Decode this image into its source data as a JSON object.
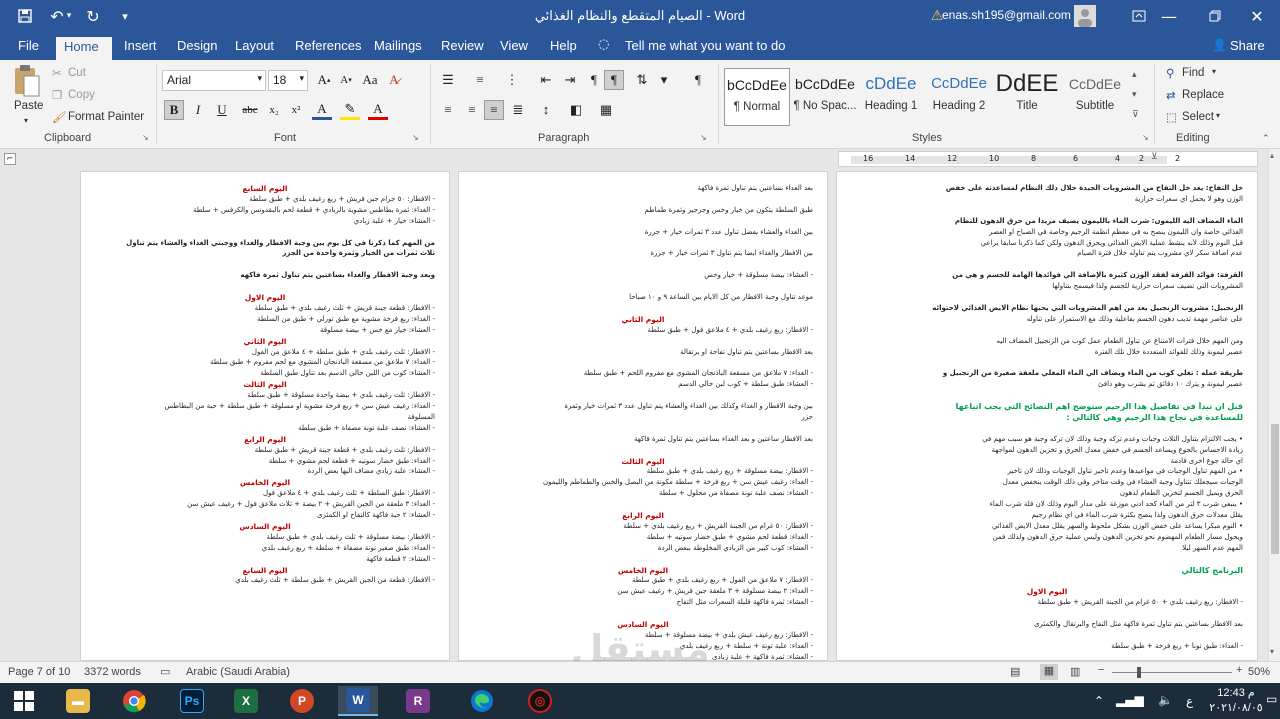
{
  "title_bar": {
    "document_title": "الصيام المتقطع والنظام الغذائي - Word",
    "account": "enas.sh195@gmail.com"
  },
  "tabs": [
    "File",
    "Home",
    "Insert",
    "Design",
    "Layout",
    "References",
    "Mailings",
    "Review",
    "View",
    "Help"
  ],
  "tell_me": "Tell me what you want to do",
  "share": "Share",
  "clipboard": {
    "paste": "Paste",
    "cut": "Cut",
    "copy": "Copy",
    "format_painter": "Format Painter",
    "group": "Clipboard"
  },
  "font": {
    "name": "Arial",
    "size": "18",
    "group": "Font"
  },
  "paragraph": {
    "group": "Paragraph"
  },
  "styles": {
    "group": "Styles",
    "items": [
      {
        "preview": "bCcDdEe",
        "name": "¶ Normal"
      },
      {
        "preview": "bCcDdEe",
        "name": "¶ No Spac..."
      },
      {
        "preview": "cDdEe",
        "name": "Heading 1"
      },
      {
        "preview": "CcDdEe",
        "name": "Heading 2"
      },
      {
        "preview": "DdEE",
        "name": "Title"
      },
      {
        "preview": "CcDdEe",
        "name": "Subtitle"
      }
    ]
  },
  "editing": {
    "find": "Find",
    "replace": "Replace",
    "select": "Select",
    "group": "Editing"
  },
  "ruler_marks": [
    "16",
    "14",
    "12",
    "10",
    "8",
    "6",
    "4",
    "2",
    "2"
  ],
  "pages": {
    "right": [
      {
        "t": "خل التفاح: يعد خل التفاح من المشروبات الجيدة خلال ذلك النظام لمساعدته على خفض",
        "c": "b"
      },
      {
        "t": "الوزن وهو لا يحمل اي سعرات حرارية",
        "c": ""
      },
      {
        "t": "",
        "c": ""
      },
      {
        "t": "الماء المضاف اليه الليمون: شرب الماء بالليمون يضيف مزيدا من حرق الدهون للنظام",
        "c": "b"
      },
      {
        "t": "الغذائي خاصة وان الليمون ينصح به في معظم انظمة الرجيم وخاصة في الصباح او العصر",
        "c": ""
      },
      {
        "t": "قبل النوم وذلك لأنه ينشط عملية الايض الغذائي ويحرق الدهون ولكن كما ذكرنا سابقا يراعي",
        "c": ""
      },
      {
        "t": "عدم اضافة سكر لاي مشروب يتم تناوله خلال فترة الصيام",
        "c": ""
      },
      {
        "t": "",
        "c": ""
      },
      {
        "t": "القرفة: فوائد القرفة لفقد الوزن كثيرة بالإضافة الي فوائدها الهامة للجسم و هي من",
        "c": "b"
      },
      {
        "t": "المشروبات التي تضيف سعرات حرارية للجسم ولذا فيسمح بتناولها",
        "c": ""
      },
      {
        "t": "",
        "c": ""
      },
      {
        "t": "الزنجبيل: مشروب الزنجبيل يعد من اهم المشروبات التي يحبها نظام الايض الغذائي لاحتوائه",
        "c": "b"
      },
      {
        "t": "على عناصر مهمة تذيب دهون الجسم بفاعلية وذلك مع الاستمرار على تناوله",
        "c": ""
      },
      {
        "t": "",
        "c": ""
      },
      {
        "t": "ومن المهم خلال فترات الامتناع عن تناول الطعام عمل كوب من الزنجبيل المضاف اليه",
        "c": ""
      },
      {
        "t": "عصير ليمونة وذلك للفوائد المتعددة خلال تلك الفترة",
        "c": ""
      },
      {
        "t": "",
        "c": ""
      },
      {
        "t": "طريقة عمله : تغلي كوب من الماء ويضاف الي الماء المغلي ملعقة صغيرة من الزنجبيل و",
        "c": "b"
      },
      {
        "t": "عصير ليمونة و يترك ١٠ دقائق ثم يشرب وهو دافئ",
        "c": ""
      },
      {
        "t": "",
        "c": ""
      },
      {
        "t": "قبل ان نبدأ في تفاصيل هذا الرجيم سنوضح اهم النصائح التي يجب اتباعها",
        "c": "g"
      },
      {
        "t": "للمساعدة في نجاح هذا الرجيم وهي كالتالي :",
        "c": "g"
      },
      {
        "t": "",
        "c": ""
      },
      {
        "t": "•  يجب الالتزام بتناول الثلاث وجبات وعدم تركه وجبة وذلك لان تركه وجبة هو سبب مهم في",
        "c": ""
      },
      {
        "t": "زيادة الاحساس بالجوع ويساعد الجسم في خفض معدل الحرق و تخزين الدهون لمواجهة",
        "c": ""
      },
      {
        "t": "اي حالة جوع اخرى قادمة",
        "c": ""
      },
      {
        "t": "•  من المهم تناول الوجبات في مواعيدها وعدم تأخير تناول الوجبات وذلك لان تأخير",
        "c": ""
      },
      {
        "t": "الوجبات سيجعلك تتناول وجبة العشاء في وقت متأخر وفي ذلك الوقت ينخفض معدل",
        "c": ""
      },
      {
        "t": "الحرق ويميل الجسم لتخزين الطعام لدهون",
        "c": ""
      },
      {
        "t": "•  ينبغي شرب ٣ لتر من الماء كحد ادني موزعة على مدار اليوم وذلك لان قلة شرب الماء",
        "c": ""
      },
      {
        "t": "يقلل معدلات حرق الدهون ولذا ينصح بكثرة شرب الماء في اي نظام رجيم",
        "c": ""
      },
      {
        "t": "•  النوم مبكرا يساعد على خفض الوزن بشكل ملحوظ والسهر يقلل معدل الايض الغذائي",
        "c": ""
      },
      {
        "t": "ويحول مسار الطعام المهضوم نحو تخزين الدهون وليس عملية حرق الدهون ولذلك فمن",
        "c": ""
      },
      {
        "t": "المهم عدم السهر ليلا",
        "c": ""
      },
      {
        "t": "",
        "c": ""
      },
      {
        "t": "البرنامج كالتالي",
        "c": "g"
      },
      {
        "t": "",
        "c": ""
      },
      {
        "t": "اليوم الاول",
        "c": "h"
      },
      {
        "t": "-  الافطار: ربع رغيف بلدي + ٥٠ غرام من الجبنة القريش + طبق سلطة",
        "c": ""
      },
      {
        "t": "",
        "c": ""
      },
      {
        "t": "بعد الافطار بساعتين يتم تناول ثمرة فاكهة مثل التفاح والبرتقال والكمثرى",
        "c": ""
      },
      {
        "t": "",
        "c": ""
      },
      {
        "t": "-  الغداء: طبق تونا + ربع فرخة + طبق سلطة",
        "c": ""
      }
    ],
    "middle": [
      {
        "t": "بعد الغداء بساعتين يتم تناول ثمرة فاكهة",
        "c": ""
      },
      {
        "t": "",
        "c": ""
      },
      {
        "t": "طبق السلطة يتكون من خيار وخس وجرجير وثمرة طماطم",
        "c": ""
      },
      {
        "t": "",
        "c": ""
      },
      {
        "t": "بين الغداء والعشاء يفضل تناول عدد ٣ ثمرات خيار + جزرة",
        "c": ""
      },
      {
        "t": "",
        "c": ""
      },
      {
        "t": "بين الافطار والغداء ايضا يتم تناول ٣ ثمرات خيار + جزرة",
        "c": ""
      },
      {
        "t": "",
        "c": ""
      },
      {
        "t": "-  العشاء: بيضة مسلوقة + خيار وخس",
        "c": ""
      },
      {
        "t": "",
        "c": ""
      },
      {
        "t": "موعد تناول وجبة الافطار من كل الايام بين الساعة ٩ و ١٠ صباحا",
        "c": ""
      },
      {
        "t": "",
        "c": ""
      },
      {
        "t": "اليوم الثاني",
        "c": "h"
      },
      {
        "t": "-  الافطار: ربع رغيف بلدي + ٤ ملاعق فول + طبق سلطة",
        "c": ""
      },
      {
        "t": "",
        "c": ""
      },
      {
        "t": "بعد الافطار بساعتين يتم تناول تفاحة او برتقالة",
        "c": ""
      },
      {
        "t": "",
        "c": ""
      },
      {
        "t": "-  الغداء: ٧ ملاعق من مسقعة الباذنجان المشوي مع مفروم اللحم + طبق سلطة",
        "c": ""
      },
      {
        "t": "-  العشاء: طبق سلطة + كوب لبن خالي الدسم",
        "c": ""
      },
      {
        "t": "",
        "c": ""
      },
      {
        "t": "بين وجبة الافطار و الغداء وكذلك بين الغداء والعشاء يتم تناول عدد ٣ ثمرات خيار وثمرة",
        "c": ""
      },
      {
        "t": "جزر",
        "c": ""
      },
      {
        "t": "",
        "c": ""
      },
      {
        "t": "بعد الافطار ساعتين و بعد الغداء بساعتين يتم تناول ثمرة فاكهة",
        "c": ""
      },
      {
        "t": "",
        "c": ""
      },
      {
        "t": "اليوم الثالث",
        "c": "h"
      },
      {
        "t": "-  الافطار: بيضة مسلوقة + ربع رغيف بلدي + طبق سلطة",
        "c": ""
      },
      {
        "t": "-  الغداء: رغيف عيش سن + ربع فرخة + سلطة مكونة من البصل والخس والطماطم والليمون",
        "c": ""
      },
      {
        "t": "-  العشاء: نصف علبة تونة مصفاة من محلول + سلطة",
        "c": ""
      },
      {
        "t": "",
        "c": ""
      },
      {
        "t": "اليوم الرابع",
        "c": "h"
      },
      {
        "t": "-  الافطار: ٥٠ غرام من الجبنة القريش + ربع رغيف بلدي + سلطة",
        "c": ""
      },
      {
        "t": "-  الغداء: قطعة لحم مشوي + طبق خضار سوتيه + سلطة",
        "c": ""
      },
      {
        "t": "-  العشاء: كوب كبير من الزبادي المخلوطة ببعض الردة",
        "c": ""
      },
      {
        "t": "",
        "c": ""
      },
      {
        "t": "اليوم الخامس",
        "c": "h"
      },
      {
        "t": "-  الافطار: ٧ ملاعق من الفول + ربع رغيف بلدي + طبق سلطة",
        "c": ""
      },
      {
        "t": "-  الغداء: ٢ بيضة مسلوقة + ٣ ملعقة جبن قريش + رغيف عيش سن",
        "c": ""
      },
      {
        "t": "-  العشاء: ثمرة فاكهة قليلة السعرات مثل التفاح",
        "c": ""
      },
      {
        "t": "",
        "c": ""
      },
      {
        "t": "اليوم السادس",
        "c": "h"
      },
      {
        "t": "-  الافطار: ربع رغيف عيش بلدي + بيضة مسلوقة + سلطة",
        "c": ""
      },
      {
        "t": "-  الغداء: علبة تونة + سلطة + ربع رغيف بلدي",
        "c": ""
      },
      {
        "t": "-  العشاء: ثمرة فاكهة + علبة زبادي",
        "c": ""
      }
    ],
    "left": [
      {
        "t": "اليوم السابع",
        "c": "h"
      },
      {
        "t": "-  الافطار: ٥٠ جرام جبن قريش + ربع رغيف بلدي + طبق سلطة",
        "c": ""
      },
      {
        "t": "-  الغداء: ثمرة بطاطس مشوية بالزبادي + قطعة لحم بالبقدونس والكرفس + سلطة",
        "c": ""
      },
      {
        "t": "-  العشاء: خيار + علبة زبادي",
        "c": ""
      },
      {
        "t": "",
        "c": ""
      },
      {
        "t": "من المهم كما ذكرنا في كل يوم بين وجبة الافطار والغداء ووجبتي الغداء والعشاء يتم تناول",
        "c": "b"
      },
      {
        "t": "ثلاث ثمرات من الخيار وثمرة واحدة من الجزر",
        "c": "b"
      },
      {
        "t": "",
        "c": ""
      },
      {
        "t": "وبعد وجبة الافطار والغداء بساعتين يتم تناول ثمرة فاكهه",
        "c": "b"
      },
      {
        "t": "",
        "c": ""
      },
      {
        "t": "اليوم الاول",
        "c": "h"
      },
      {
        "t": "-  الافطار: قطعة جبنة قريش + ثلث رغيف بلدي + طبق سلطة",
        "c": ""
      },
      {
        "t": "-  الغداء: ربع فرخة مشوية مع طبق تورلي + طبق من السلطة",
        "c": ""
      },
      {
        "t": "-  العشاء: خيار مع خس + بيضة مسلوقة",
        "c": ""
      },
      {
        "t": "اليوم الثاني",
        "c": "h"
      },
      {
        "t": "-  الافطار: ثلث رغيف بلدي + طبق سلطة + ٤ ملاعق من الفول",
        "c": ""
      },
      {
        "t": "-  الغداء: ٧ ملاعق من مسقعة الباذنجان المشوي مع لحم مفروم + طبق سلطة",
        "c": ""
      },
      {
        "t": "-  العشاء: كوب من اللبن خالي الدسم بعد تناول طبق السلطة",
        "c": ""
      },
      {
        "t": "اليوم الثالث",
        "c": "h"
      },
      {
        "t": "-  الافطار: ثلث رغيف بلدي + بيضة واحدة مسلوقة + طبق سلطة",
        "c": ""
      },
      {
        "t": "-  الغداء: رغيف عيش سن + ربع فرخة مشوية او مسلوقة + طبق سلطة + حبة من البطاطس",
        "c": ""
      },
      {
        "t": "المسلوقة",
        "c": ""
      },
      {
        "t": "-  العشاء: نصف علبة تونة مصفاة + طبق سلطة",
        "c": ""
      },
      {
        "t": "اليوم الرابع",
        "c": "h"
      },
      {
        "t": "-  الافطار: ثلث رغيف بلدي + قطعة جبنة قريش + طبق سلطة",
        "c": ""
      },
      {
        "t": "-  الغداء: طبق خضار سوتيه + قطعة لحم مشوي + سلطة",
        "c": ""
      },
      {
        "t": "-  العشاء: علبة زبادي مضاف اليها بعض الردة",
        "c": ""
      },
      {
        "t": "اليوم الخامس",
        "c": "h"
      },
      {
        "t": "-  الافطار: طبق السلطة + ثلث رغيف بلدي + ٤ ملاعق فول",
        "c": ""
      },
      {
        "t": "-  الغداء: ٣ ملعقة من الجبن القريش + ٢ بيضة + ثلاث ملاعق فول + رغيف عيش سن",
        "c": ""
      },
      {
        "t": "-  العشاء: ٢ حبة فاكهة كالتفاح او الكمثرى",
        "c": ""
      },
      {
        "t": "اليوم السادس",
        "c": "h"
      },
      {
        "t": "-  الافطار: بيضة مسلوقة + ثلث رغيف بلدي + طبق سلطة",
        "c": ""
      },
      {
        "t": "-  الغداء: طبق صغير تونة مصفاة + سلطة + ربع رغيف بلدي",
        "c": ""
      },
      {
        "t": "-  العشاء: ٢ قطعة فاكهة",
        "c": ""
      },
      {
        "t": "اليوم السابع",
        "c": "h"
      },
      {
        "t": "-  الافطار: قطعة من الجبن القريش + طبق سلطة + ثلث رغيف بلدي",
        "c": ""
      }
    ]
  },
  "status_bar": {
    "page": "Page 7 of 10",
    "words": "3372 words",
    "language": "Arabic (Saudi Arabia)",
    "zoom": "50%",
    "zoom_fraction": 0.5
  },
  "watermark": {
    "text": "مستقل",
    "sub": "mostaql.com"
  },
  "taskbar": {
    "time": "12:43 م",
    "date": "٢٠٢١/٠٨/٠٥",
    "lang": "ع"
  },
  "colors": {
    "titlebar": "#2b579a",
    "heading_red": "#c00000",
    "heading_green": "#00a050",
    "taskbar": "#1d2c3a"
  }
}
